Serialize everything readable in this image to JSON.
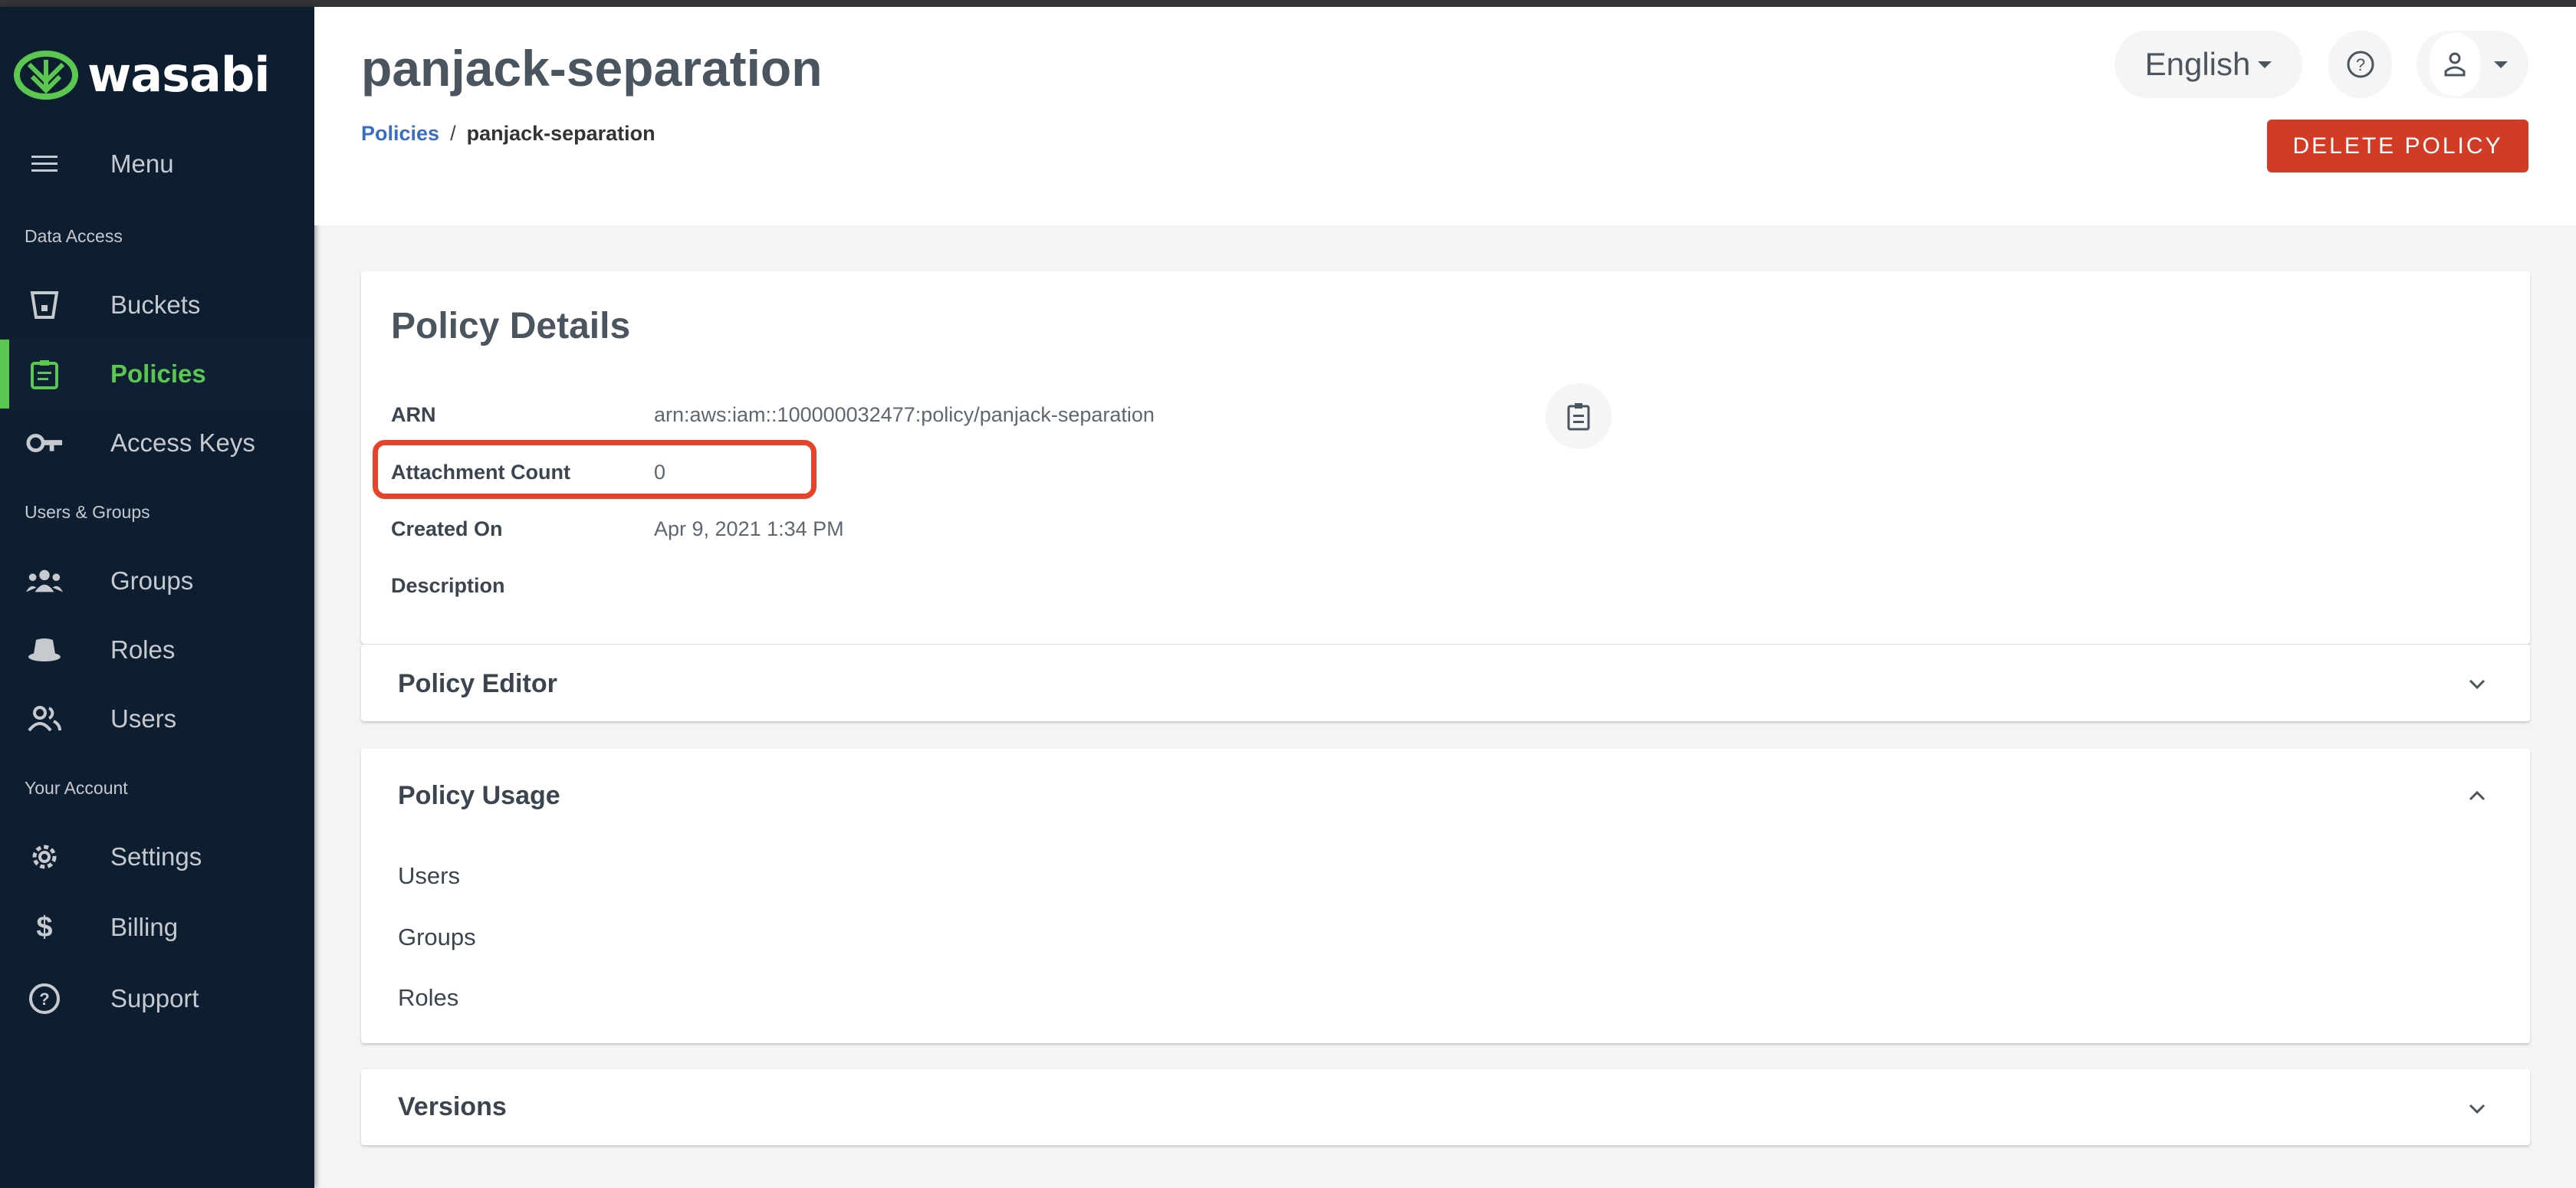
{
  "brand": {
    "name": "wasabi",
    "accent": "#5bc750",
    "sidebar_bg": "#0e1e31",
    "danger": "#d23c27"
  },
  "sidebar": {
    "menu_label": "Menu",
    "sections": [
      "Data Access",
      "Users & Groups",
      "Your Account"
    ],
    "items": [
      {
        "label": "Buckets",
        "icon": "bucket-icon"
      },
      {
        "label": "Policies",
        "icon": "clipboard-icon",
        "active": true
      },
      {
        "label": "Access Keys",
        "icon": "key-icon"
      },
      {
        "label": "Groups",
        "icon": "groups-icon"
      },
      {
        "label": "Roles",
        "icon": "hat-icon"
      },
      {
        "label": "Users",
        "icon": "users-icon"
      },
      {
        "label": "Settings",
        "icon": "gear-icon"
      },
      {
        "label": "Billing",
        "icon": "dollar-icon"
      },
      {
        "label": "Support",
        "icon": "help-icon"
      }
    ]
  },
  "header": {
    "title": "panjack-separation",
    "breadcrumb": {
      "parent": "Policies",
      "separator": "/",
      "current": "panjack-separation"
    },
    "language": "English",
    "delete_label": "DELETE POLICY"
  },
  "details": {
    "title": "Policy Details",
    "rows": [
      {
        "label": "ARN",
        "value": "arn:aws:iam::100000032477:policy/panjack-separation"
      },
      {
        "label": "Attachment Count",
        "value": "0"
      },
      {
        "label": "Created On",
        "value": "Apr 9, 2021 1:34 PM"
      },
      {
        "label": "Description",
        "value": ""
      }
    ]
  },
  "panels": {
    "editor": {
      "title": "Policy Editor",
      "expanded": false
    },
    "usage": {
      "title": "Policy Usage",
      "expanded": true,
      "items": [
        "Users",
        "Groups",
        "Roles"
      ]
    },
    "versions": {
      "title": "Versions",
      "expanded": false
    }
  }
}
